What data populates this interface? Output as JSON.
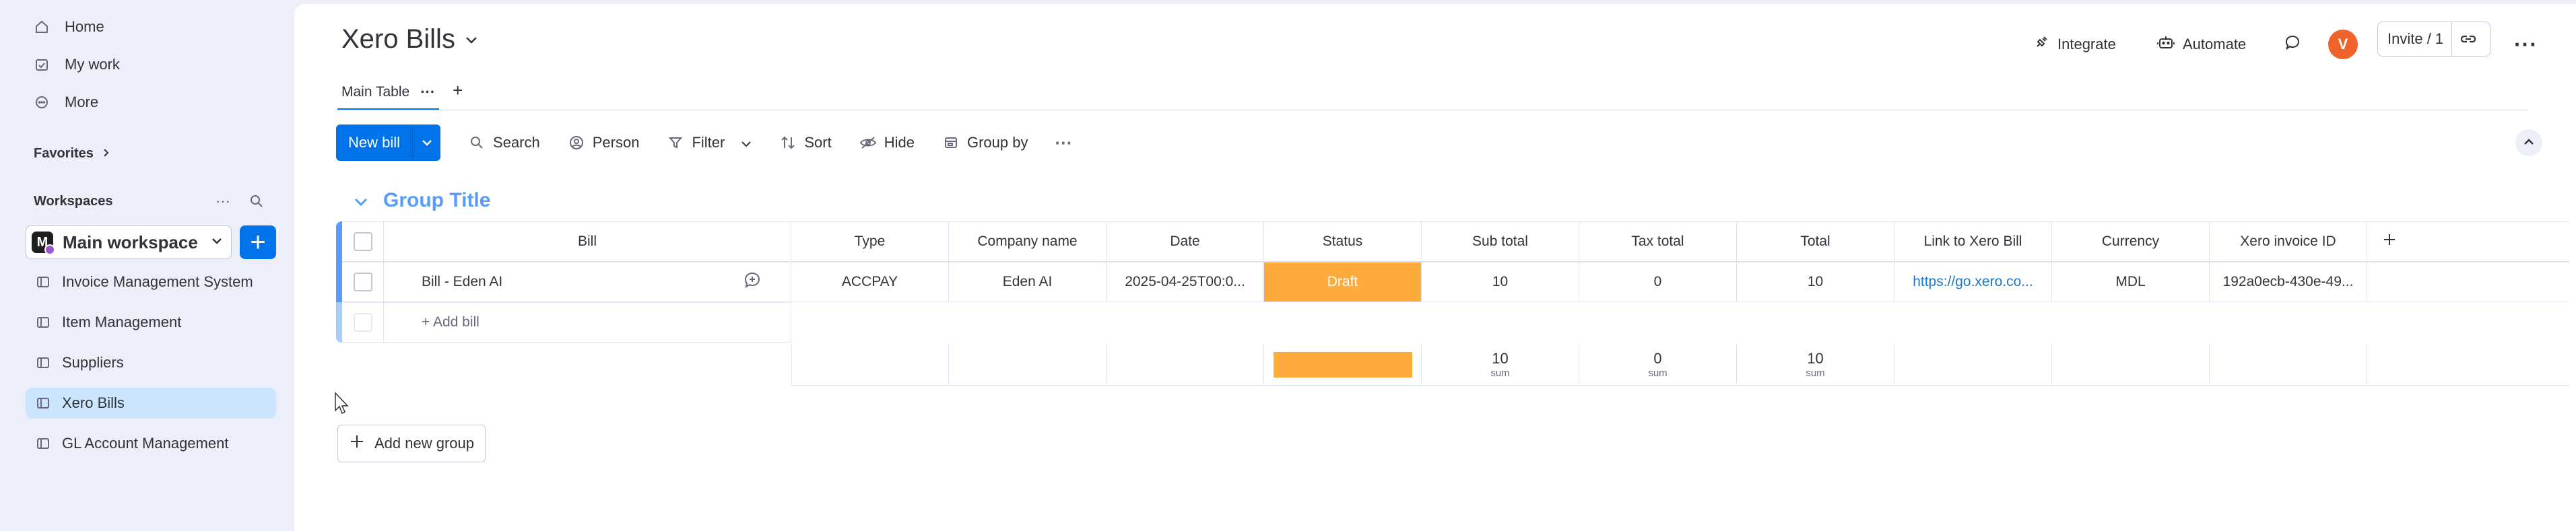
{
  "sidebar": {
    "nav": [
      {
        "label": "Home",
        "icon": "home-icon"
      },
      {
        "label": "My work",
        "icon": "calendar-check-icon"
      },
      {
        "label": "More",
        "icon": "more-circle-icon"
      }
    ],
    "favorites_label": "Favorites",
    "workspaces_label": "Workspaces",
    "workspace": {
      "logo_letter": "M",
      "name": "Main workspace"
    },
    "boards": [
      {
        "label": "Invoice Management System",
        "active": false
      },
      {
        "label": "Item Management",
        "active": false
      },
      {
        "label": "Suppliers",
        "active": false
      },
      {
        "label": "Xero Bills",
        "active": true
      },
      {
        "label": "GL Account Management",
        "active": false
      }
    ]
  },
  "header": {
    "title": "Xero Bills",
    "integrate_label": "Integrate",
    "automate_label": "Automate",
    "avatar_letter": "V",
    "invite_label": "Invite / 1"
  },
  "tabs": [
    {
      "label": "Main Table",
      "active": true
    }
  ],
  "toolbar": {
    "new_button": "New bill",
    "search": "Search",
    "person": "Person",
    "filter": "Filter",
    "sort": "Sort",
    "hide": "Hide",
    "group_by": "Group by"
  },
  "group": {
    "title": "Group Title",
    "color": "#579bfc",
    "columns": [
      "Bill",
      "Type",
      "Company name",
      "Date",
      "Status",
      "Sub total",
      "Tax total",
      "Total",
      "Link to Xero Bill",
      "Currency",
      "Xero invoice ID"
    ],
    "rows": [
      {
        "bill": "Bill - Eden AI",
        "type": "ACCPAY",
        "company": "Eden AI",
        "date": "2025-04-25T00:0...",
        "status": "Draft",
        "status_color": "#fdab3d",
        "sub_total": "10",
        "tax_total": "0",
        "total": "10",
        "link": "https://go.xero.co...",
        "currency": "MDL",
        "invoice_id": "192a0ecb-430e-49..."
      }
    ],
    "add_item_label": "+ Add bill",
    "summary": {
      "sub_total": "10",
      "tax_total": "0",
      "total": "10",
      "sum_label": "sum"
    }
  },
  "add_group_label": "Add new group"
}
